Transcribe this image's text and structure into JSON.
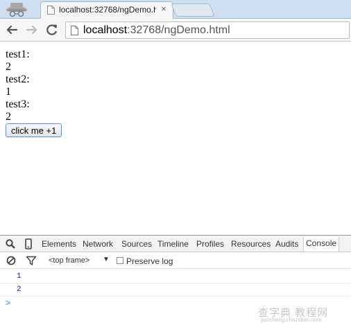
{
  "browser": {
    "tab_title": "localhost:32768/ngDemo.h",
    "tab_close": "×",
    "url_host": "localhost",
    "url_rest": ":32768/ngDemo.html"
  },
  "icons": {
    "incognito": "incognito-icon",
    "page": "page-icon",
    "back": "back-arrow-icon",
    "forward": "forward-arrow-icon",
    "reload": "reload-icon",
    "search": "search-icon",
    "device": "device-mode-icon",
    "clear": "clear-console-icon",
    "filter": "filter-icon"
  },
  "page": {
    "items": [
      {
        "label": "test1:",
        "value": "2"
      },
      {
        "label": "test2:",
        "value": "1"
      },
      {
        "label": "test3:",
        "value": "2"
      }
    ],
    "button_label": "click me +1"
  },
  "devtools": {
    "tabs": [
      "Elements",
      "Network",
      "Sources",
      "Timeline",
      "Profiles",
      "Resources",
      "Audits",
      "Console"
    ],
    "active_tab": "Console",
    "frame_selector": "<top frame>",
    "frame_arrow": "▼",
    "preserve_log": "Preserve log",
    "console_lines": [
      "1",
      "2"
    ],
    "prompt": ">"
  },
  "watermark": {
    "main": "查字典 教程网",
    "sub": "jiaocheng.chazidian.com"
  },
  "colors": {
    "tab_strip": "#cfdff2",
    "button_focus_border": "#4d90fe",
    "console_text": "#1a1aa6",
    "prompt": "#367cf1"
  }
}
